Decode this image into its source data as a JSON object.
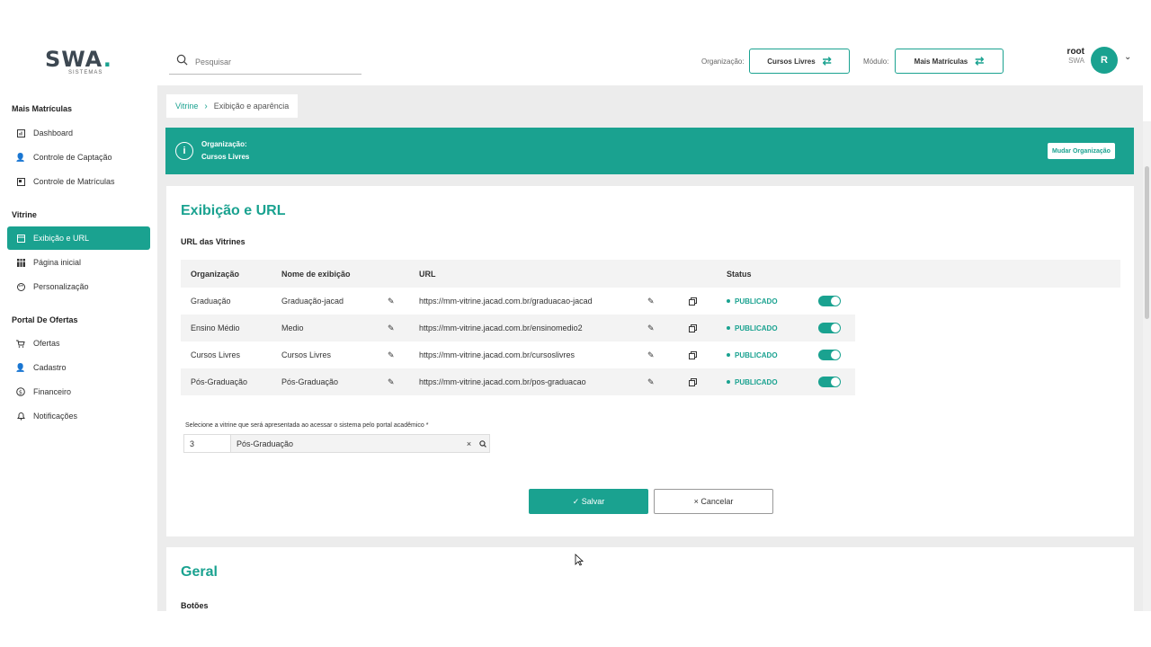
{
  "header": {
    "logo_text": "SWA",
    "logo_sub": "SISTEMAS",
    "search_placeholder": "Pesquisar",
    "org_label": "Organização:",
    "org_value": "Cursos Livres",
    "module_label": "Módulo:",
    "module_value": "Mais Matrículas",
    "user_name": "root",
    "user_org": "SWA",
    "avatar_initial": "R",
    "icons": {
      "search": "search-icon",
      "swap": "swap-icon",
      "caret": "chevron-down-icon"
    }
  },
  "sidebar": {
    "sections": [
      {
        "title": "Mais Matrículas",
        "items": [
          {
            "label": "Dashboard",
            "icon": "dashboard-icon"
          },
          {
            "label": "Controle de Captação",
            "icon": "user-add-icon"
          },
          {
            "label": "Controle de Matrículas",
            "icon": "enrollment-icon"
          }
        ]
      },
      {
        "title": "Vitrine",
        "items": [
          {
            "label": "Exibição e URL",
            "icon": "window-icon",
            "active": true
          },
          {
            "label": "Página inicial",
            "icon": "grid-icon"
          },
          {
            "label": "Personalização",
            "icon": "palette-icon"
          }
        ]
      },
      {
        "title": "Portal De Ofertas",
        "items": [
          {
            "label": "Ofertas",
            "icon": "cart-icon"
          },
          {
            "label": "Cadastro",
            "icon": "user-edit-icon"
          },
          {
            "label": "Financeiro",
            "icon": "dollar-icon"
          },
          {
            "label": "Notificações",
            "icon": "bell-icon"
          }
        ]
      }
    ]
  },
  "breadcrumb": {
    "parent": "Vitrine",
    "current": "Exibição e aparência"
  },
  "banner": {
    "label": "Organização:",
    "value": "Cursos Livres",
    "button": "Mudar Organização"
  },
  "section_url": {
    "title": "Exibição e URL",
    "subtitle": "URL das Vitrines",
    "columns": [
      "Organização",
      "Nome de exibição",
      "URL",
      "Status"
    ],
    "rows": [
      {
        "org": "Graduação",
        "name": "Graduação-jacad",
        "url": "https://mm-vitrine.jacad.com.br/graduacao-jacad",
        "status": "PUBLICADO",
        "enabled": true
      },
      {
        "org": "Ensino Médio",
        "name": "Medio",
        "url": "https://mm-vitrine.jacad.com.br/ensinomedio2",
        "status": "PUBLICADO",
        "enabled": true
      },
      {
        "org": "Cursos Livres",
        "name": "Cursos Livres",
        "url": "https://mm-vitrine.jacad.com.br/cursoslivres",
        "status": "PUBLICADO",
        "enabled": true
      },
      {
        "org": "Pós-Graduação",
        "name": "Pós-Graduação",
        "url": "https://mm-vitrine.jacad.com.br/pos-graduacao",
        "status": "PUBLICADO",
        "enabled": true
      }
    ],
    "select_label": "Selecione a vitrine que será apresentada ao acessar o sistema pelo portal acadêmico *",
    "select_code": "3",
    "select_value": "Pós-Graduação",
    "clear_symbol": "×",
    "search_symbol": "🔍",
    "save_label": "Salvar",
    "save_icon": "✓",
    "cancel_label": "Cancelar",
    "cancel_icon": "×"
  },
  "section_general": {
    "title": "Geral",
    "subtitle": "Botões"
  },
  "colors": {
    "accent": "#1aa290",
    "background": "#ececec"
  }
}
